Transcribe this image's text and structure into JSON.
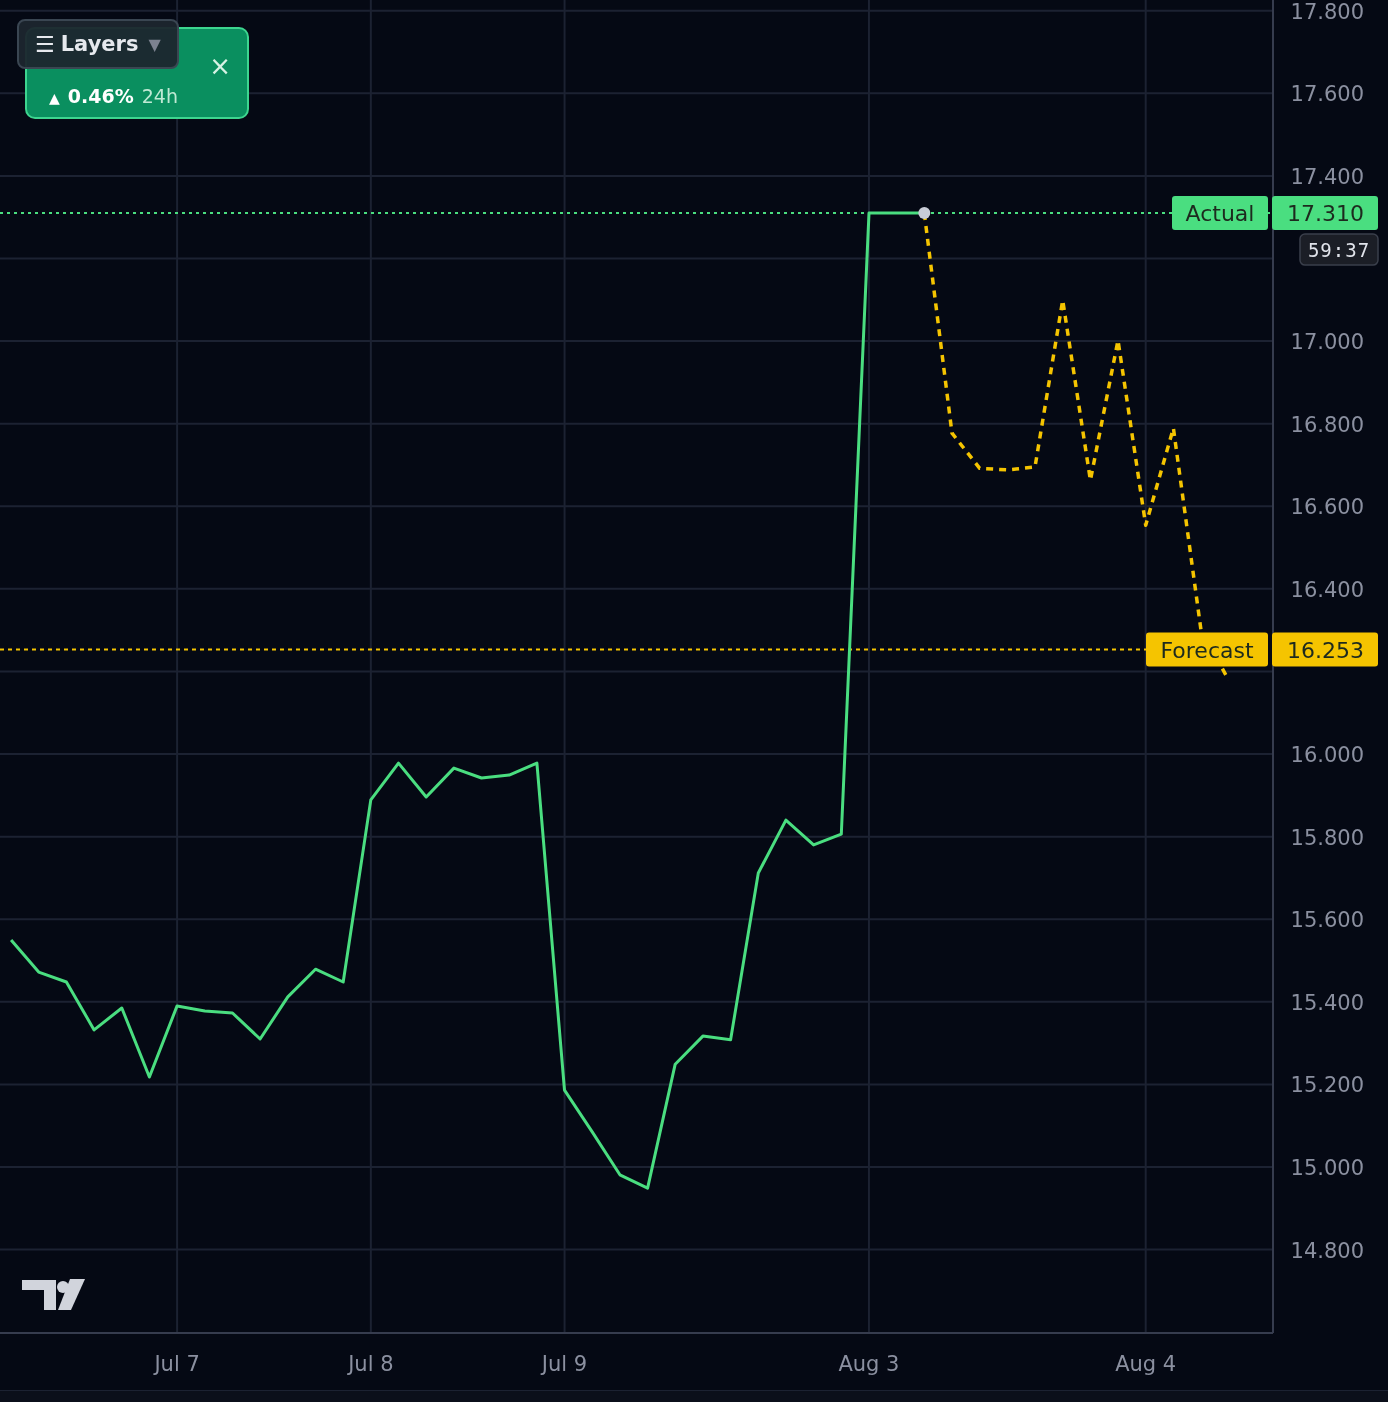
{
  "layers_button": {
    "icon": "☰",
    "label": "Layers",
    "caret": "▼"
  },
  "ticker_card": {
    "arrow": "▲",
    "change": "0.46%",
    "period": "24h",
    "close": "×"
  },
  "chart_data": {
    "type": "line",
    "grid": true,
    "legend": "right",
    "ylim": [
      14.598,
      17.826
    ],
    "categories": [
      null,
      null,
      null,
      null,
      null,
      null,
      "Jul 7",
      null,
      null,
      null,
      null,
      null,
      null,
      "Jul 8",
      null,
      null,
      null,
      null,
      null,
      null,
      "Jul 9",
      null,
      null,
      null,
      null,
      null,
      null,
      null,
      null,
      null,
      null,
      "Aug 3",
      null,
      null,
      null,
      null,
      null,
      null,
      null,
      null,
      null,
      "Aug 4",
      null,
      null,
      null
    ],
    "series": [
      {
        "name": "Actual",
        "color": "#4ade80",
        "line_style": "solid",
        "values": [
          15.55,
          15.472,
          15.448,
          15.332,
          15.385,
          15.218,
          15.39,
          15.378,
          15.373,
          15.31,
          15.412,
          15.479,
          15.448,
          15.889,
          15.978,
          15.896,
          15.966,
          15.942,
          15.949,
          15.978,
          15.186,
          15.085,
          14.981,
          14.949,
          15.249,
          15.317,
          15.308,
          15.712,
          15.84,
          15.78,
          15.806,
          17.31,
          17.31,
          17.31,
          null,
          null,
          null,
          null,
          null,
          null,
          null,
          null,
          null,
          null,
          null
        ]
      },
      {
        "name": "Forecast",
        "color": "#f5c400",
        "line_style": "dashed",
        "values": [
          null,
          null,
          null,
          null,
          null,
          null,
          null,
          null,
          null,
          null,
          null,
          null,
          null,
          null,
          null,
          null,
          null,
          null,
          null,
          null,
          null,
          null,
          null,
          null,
          null,
          null,
          null,
          null,
          null,
          null,
          null,
          null,
          null,
          17.31,
          16.777,
          16.692,
          16.688,
          16.695,
          17.099,
          16.663,
          17.002,
          16.554,
          16.789,
          16.3,
          16.179
        ]
      }
    ],
    "yticks": [
      {
        "value": 17.8,
        "label": "17.800"
      },
      {
        "value": 17.6,
        "label": "17.600"
      },
      {
        "value": 17.4,
        "label": "17.400"
      },
      {
        "value": 17.0,
        "label": "17.000"
      },
      {
        "value": 16.8,
        "label": "16.800"
      },
      {
        "value": 16.6,
        "label": "16.600"
      },
      {
        "value": 16.4,
        "label": "16.400"
      },
      {
        "value": 16.0,
        "label": "16.000"
      },
      {
        "value": 15.8,
        "label": "15.800"
      },
      {
        "value": 15.6,
        "label": "15.600"
      },
      {
        "value": 15.4,
        "label": "15.400"
      },
      {
        "value": 15.2,
        "label": "15.200"
      },
      {
        "value": 15.0,
        "label": "15.000"
      },
      {
        "value": 14.8,
        "label": "14.800"
      }
    ],
    "ref_lines": [
      {
        "axis": "y",
        "value": 17.31,
        "label": "17.310",
        "color": "#4ade80"
      },
      {
        "axis": "y",
        "value": 16.253,
        "label": "16.253",
        "color": "#f5c400"
      }
    ]
  },
  "countdown": "59:37"
}
